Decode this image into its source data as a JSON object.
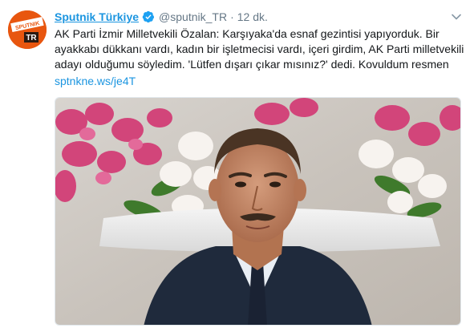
{
  "tweet": {
    "display_name": "Sputnik Türkiye",
    "handle": "@sputnik_TR",
    "separator": "·",
    "time": "12 dk.",
    "text_lines": [
      "AK Parti İzmir Milletvekili Özalan: Karşıyaka'da esnaf gezintisi yapıyorduk. Bir",
      "ayakkabı dükkanı vardı, kadın bir işletmecisi vardı, içeri girdim, AK Parti milletvekili",
      "adayı olduğumu söyledim. 'Lütfen dışarı çıkar mısınız?' dedi.  Kovuldum resmen"
    ],
    "link": "sptnkne.ws/je4T",
    "avatar_text": "SPUTNIK",
    "avatar_badge": "TR",
    "colors": {
      "link": "#1b95e0",
      "avatar": "#e8560f",
      "verified": "#1da1f2",
      "muted": "#657786"
    },
    "icons": {
      "verified": "verified-badge-icon",
      "more": "chevron-down-icon"
    }
  }
}
